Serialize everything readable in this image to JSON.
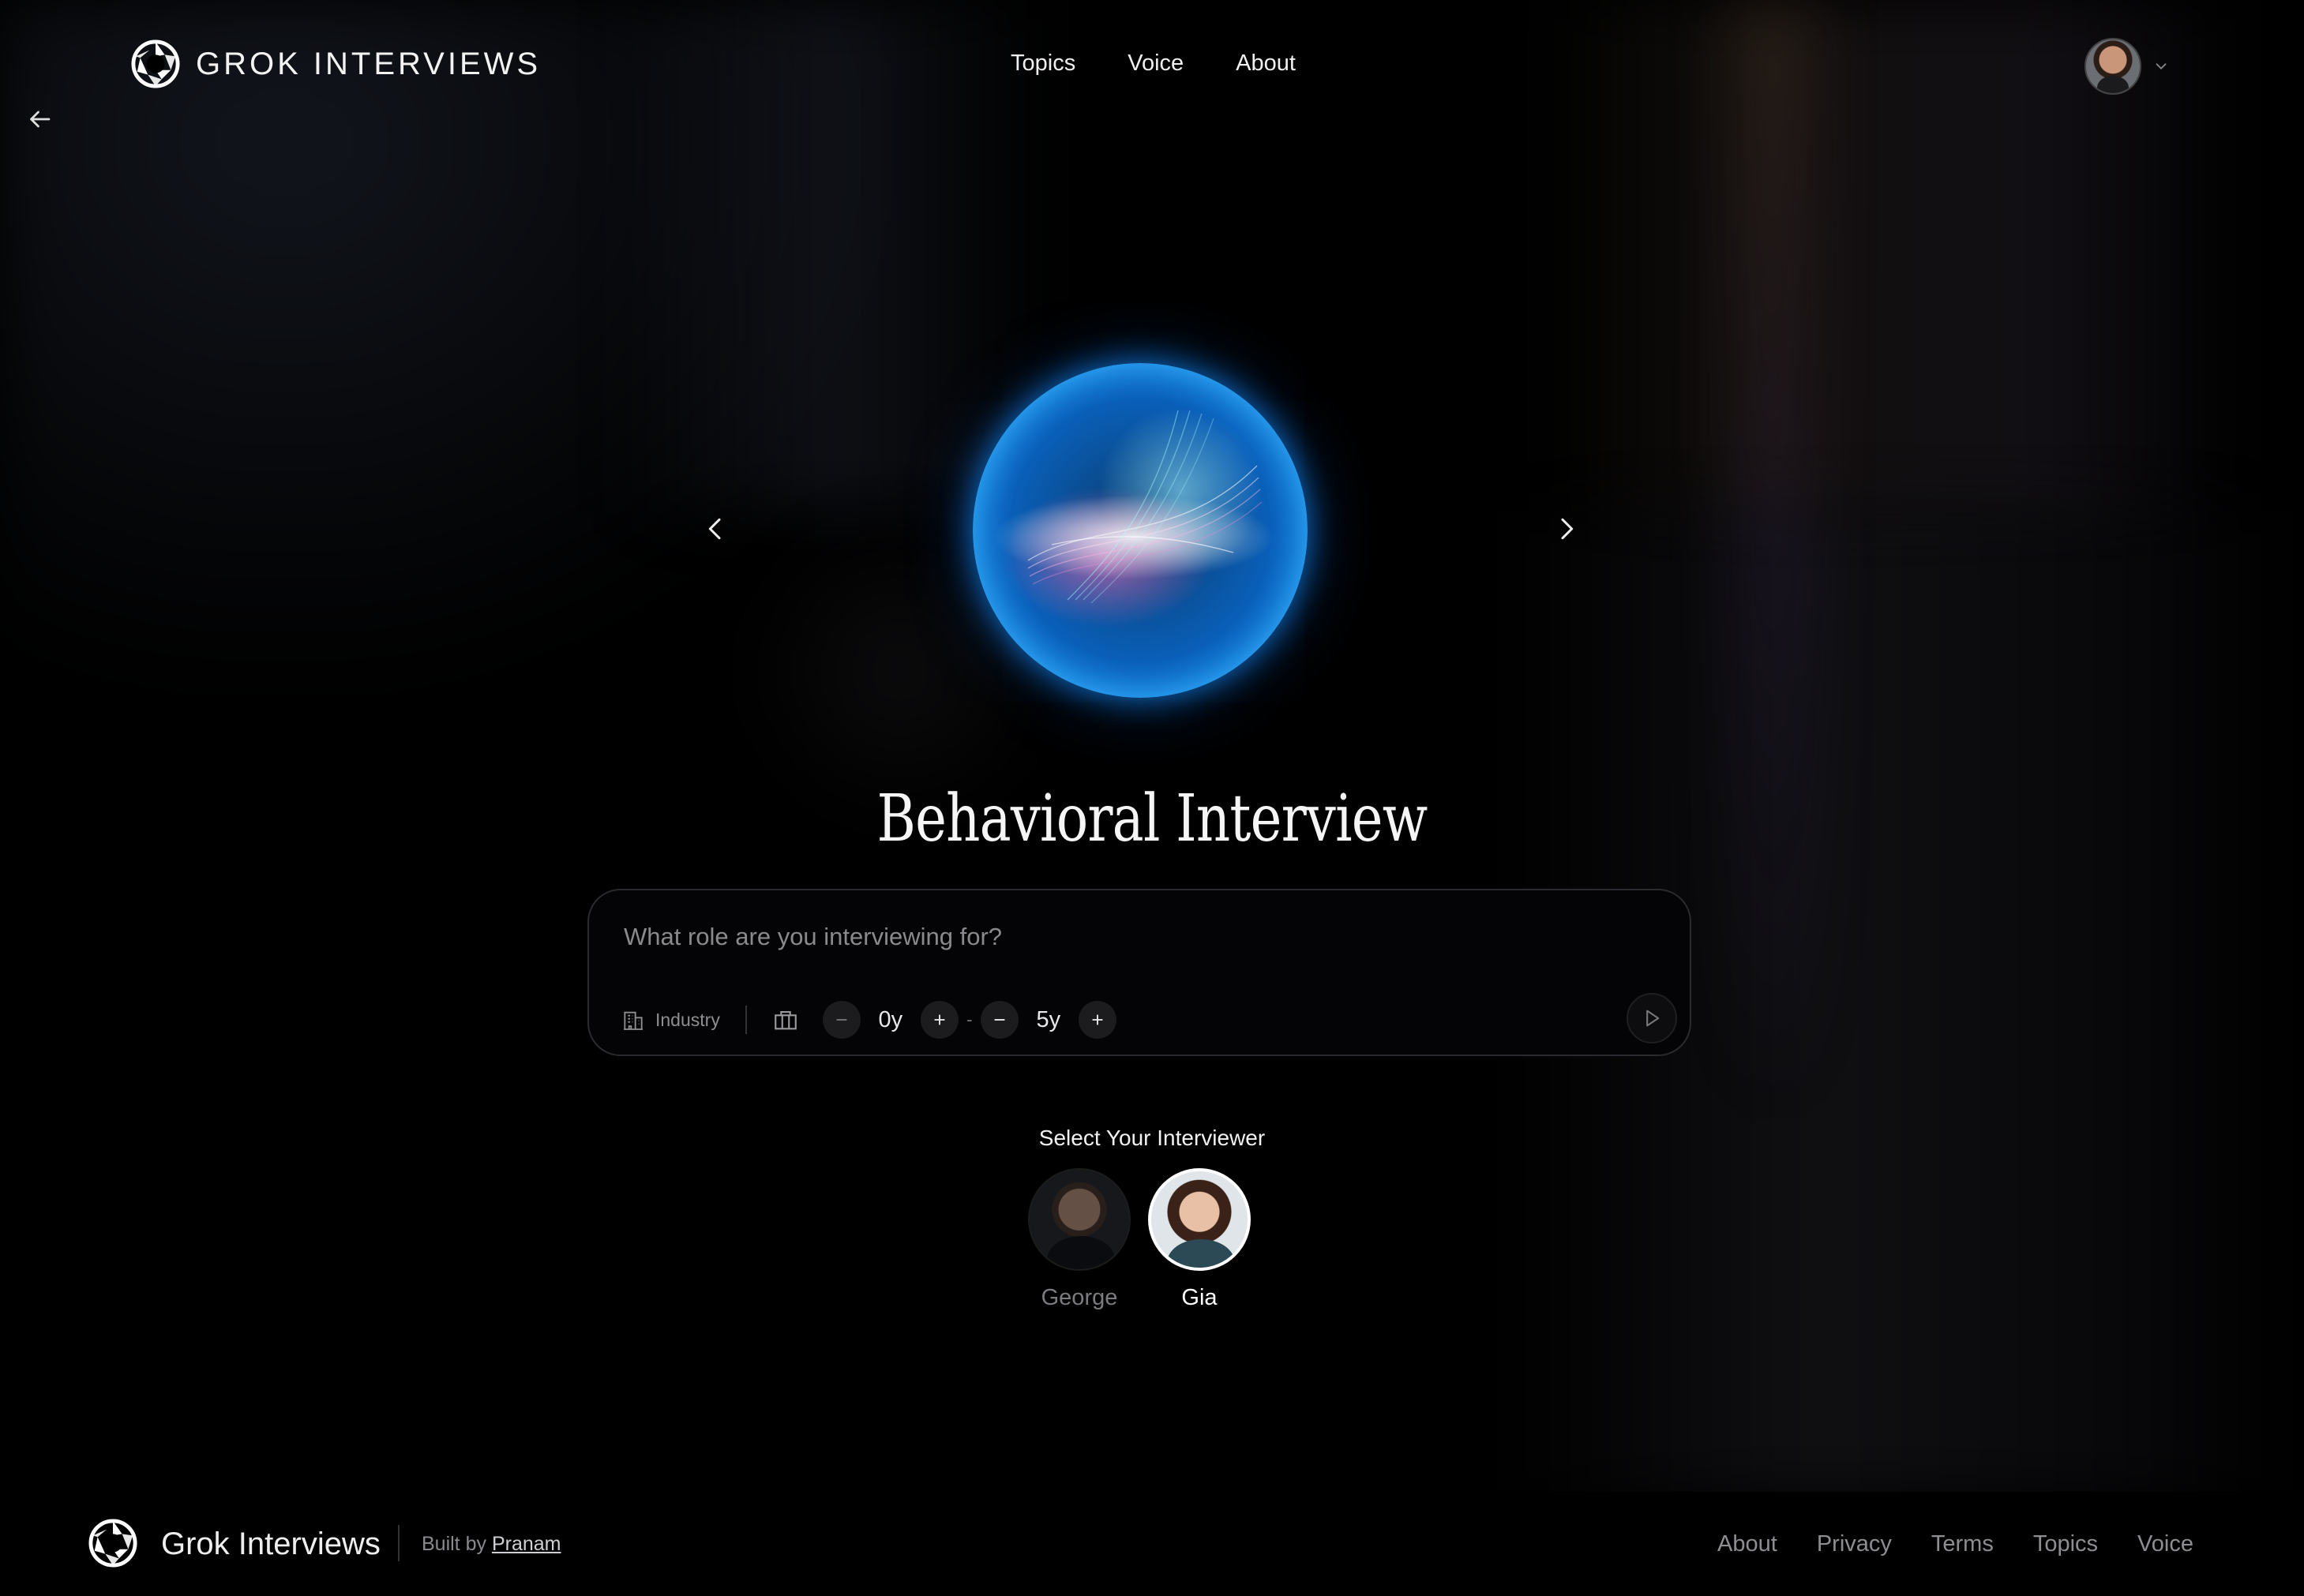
{
  "header": {
    "brand": "GROK INTERVIEWS",
    "nav": [
      "Topics",
      "Voice",
      "About"
    ]
  },
  "hero": {
    "title": "Behavioral Interview"
  },
  "prompt": {
    "placeholder": "What role are you interviewing for?",
    "industry_label": "Industry",
    "min_years": "0y",
    "max_years": "5y",
    "range_separator": "-"
  },
  "interviewers": {
    "heading": "Select Your Interviewer",
    "options": [
      "George",
      "Gia"
    ],
    "selected": "Gia"
  },
  "footer": {
    "brand": "Grok Interviews",
    "built_by_prefix": "Built by",
    "built_by_name": "Pranam",
    "links": [
      "About",
      "Privacy",
      "Terms",
      "Topics",
      "Voice"
    ]
  },
  "colors": {
    "background": "#000000",
    "orb_accent": "#1a9bff",
    "text": "#f2f2f2",
    "muted_text": "#8a8a8e"
  },
  "icons": [
    "logo-icon",
    "back-arrow-icon",
    "chevron-down-icon",
    "chevron-left-icon",
    "chevron-right-icon",
    "building-icon",
    "briefcase-icon",
    "minus-icon",
    "plus-icon",
    "play-icon"
  ]
}
